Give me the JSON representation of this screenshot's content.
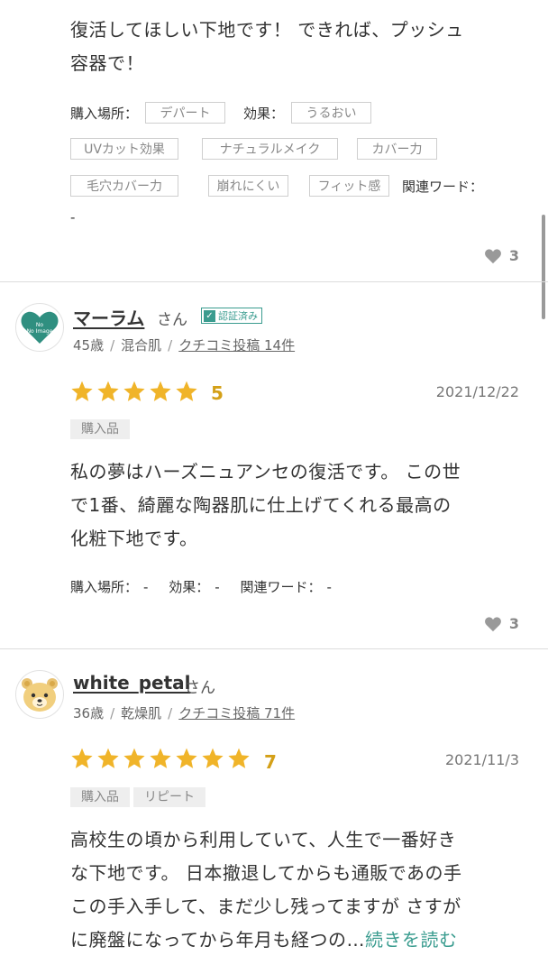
{
  "review0": {
    "body_line1": "復活してほしい下地です！ できれば、プッシュ",
    "body_line2": "容器で！",
    "purchase_label": "購入場所：",
    "purchase_value": "デパート",
    "effect_label": "効果：",
    "effects": [
      "うるおい",
      "UVカット効果",
      "ナチュラルメイク",
      "カバー力",
      "毛穴カバー力",
      "崩れにくい",
      "フィット感"
    ],
    "keyword_label": "関連ワード：",
    "keyword_value": "-",
    "likes": "3"
  },
  "review1": {
    "avatar_text": "No Image",
    "username": "マーラム",
    "honorific": "さん",
    "verified": "認証済み",
    "age": "45歳",
    "skin": "混合肌",
    "posts": "クチコミ投稿 14件",
    "rating": 5,
    "score": "5",
    "date": "2021/12/22",
    "tags": [
      "購入品"
    ],
    "body_line1": "私の夢はハーズニュアンセの復活です。 この世",
    "body_line2": "で1番、綺麗な陶器肌に仕上げてくれる最高の",
    "body_line3": "化粧下地です。",
    "purchase_label": "購入場所：",
    "purchase_value": "-",
    "effect_label": "効果：",
    "effect_value": "-",
    "keyword_label": "関連ワード：",
    "keyword_value": "-",
    "likes": "3"
  },
  "review2": {
    "username": "white_petal",
    "honorific": "さん",
    "age": "36歳",
    "skin": "乾燥肌",
    "posts": "クチコミ投稿 71件",
    "rating": 7,
    "score": "7",
    "date": "2021/11/3",
    "tags": [
      "購入品",
      "リピート"
    ],
    "body_line1": "高校生の頃から利用していて、人生で一番好き",
    "body_line2": "な下地です。 日本撤退してからも通販であの手",
    "body_line3": "この手入手して、まだ少し残ってますが さすが",
    "body_line4": "に廃盤になってから年月も経つの…",
    "read_more": "続きを読む"
  },
  "colors": {
    "accent": "#3a9c8f",
    "star": "#f0b429",
    "score": "#d4a017"
  }
}
